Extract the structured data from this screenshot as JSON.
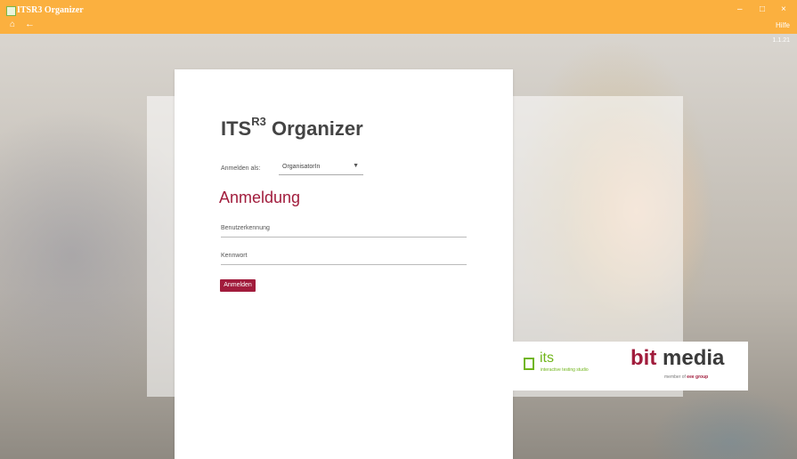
{
  "app": {
    "title": "ITSR3 Organizer",
    "version": "1.1.21",
    "help_label": "Hilfe"
  },
  "window_controls": {
    "minimize": "–",
    "maximize": "□",
    "close": "×"
  },
  "nav": {
    "home_icon": "⌂",
    "back_icon": "←"
  },
  "login": {
    "brand_main": "ITS",
    "brand_sup": "R3",
    "brand_rest": "Organizer",
    "login_as_label": "Anmelden als:",
    "role_selected": "OrganisatorIn",
    "section_title": "Anmeldung",
    "username_placeholder": "Benutzerkennung",
    "password_placeholder": "Kennwort",
    "submit_label": "Anmelden"
  },
  "logos": {
    "its_name": "its",
    "its_tagline": "interactive testing studio",
    "bitmedia_bit": "bit",
    "bitmedia_media": "media",
    "bitmedia_member": "member of",
    "bitmedia_group": "eee group"
  },
  "colors": {
    "titlebar": "#fbb03f",
    "accent": "#a11c3c",
    "its_green": "#70b51a"
  }
}
